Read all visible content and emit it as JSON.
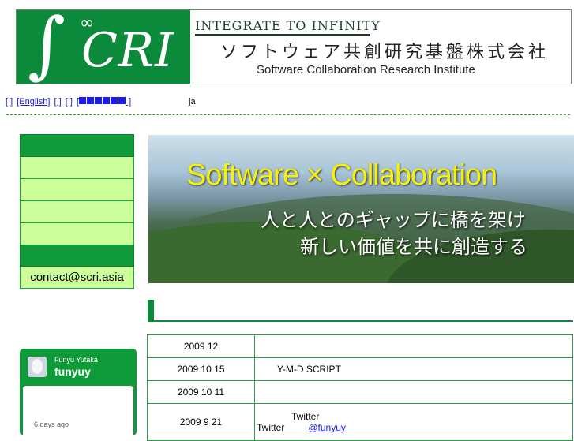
{
  "header": {
    "logo_integral": "∫",
    "logo_infinity": "∞",
    "logo_text": "CRI",
    "tagline": "INTEGRATE TO INFINITY",
    "company_jp": "ソフトウェア共創研究基盤株式会社",
    "company_en": "Software Collaboration Research Institute"
  },
  "lang_nav": {
    "items": [
      "[ ]",
      "[English]",
      "[ ]",
      "[ ]"
    ],
    "blocked_item_open": "[",
    "blocked_item_close": " ]",
    "code": "ja"
  },
  "side_menu": {
    "items": [
      "",
      "",
      "",
      ""
    ],
    "contact": "contact@scri.asia"
  },
  "banner": {
    "title": "Software × Collaboration",
    "subtitle_line1": "人と人とのギャップに橋を架け",
    "subtitle_line2": "新しい価値を共に創造する"
  },
  "news": [
    {
      "date": "2009 12",
      "text": ""
    },
    {
      "date": "2009 10 15",
      "text": "Y-M-D SCRIPT"
    },
    {
      "date": "2009 10 11",
      "text": ""
    },
    {
      "date": "2009 9 21",
      "text_line1": "Twitter",
      "text_line2": "Twitter",
      "link": "@funyuy"
    }
  ],
  "twitter": {
    "display_name": "Funyu Yutaka",
    "handle": "funyuy",
    "time": "6 days ago"
  },
  "colors": {
    "brand_green": "#0a8a3a",
    "menu_light": "#ccff99",
    "banner_title": "#f4f010",
    "link": "#1a1aee"
  }
}
